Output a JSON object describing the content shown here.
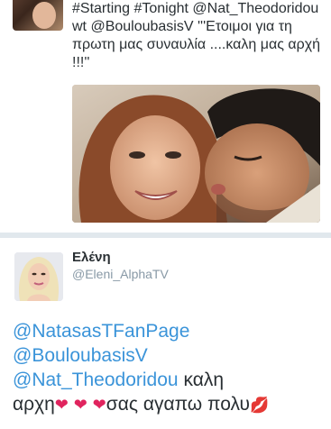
{
  "tweet_top": {
    "text": "#Starting #Tonight @Nat_Theodoridou\nwt @BouloubasisV '''Ετοιμοι για τη πρωτη μας συναυλία ....καλη μας αρχή !!!''"
  },
  "tweet_bottom": {
    "display_name": "Ελένη",
    "username": "@Eleni_AlphaTV",
    "mention_1": "@NatasasTFanPage",
    "mention_2": "@BouloubasisV",
    "mention_3": "@Nat_Theodoridou",
    "text_after_mention_3": " καλη",
    "text_line_4_start": "αρχη",
    "heart_glyph": "❤",
    "text_after_hearts": "σας αγαπω πολυ",
    "lips_glyph": "💋"
  },
  "colors": {
    "link": "#3b94d9",
    "divider": "#e1e8ed",
    "username": "#8899a6",
    "heart": "#e0245e"
  }
}
